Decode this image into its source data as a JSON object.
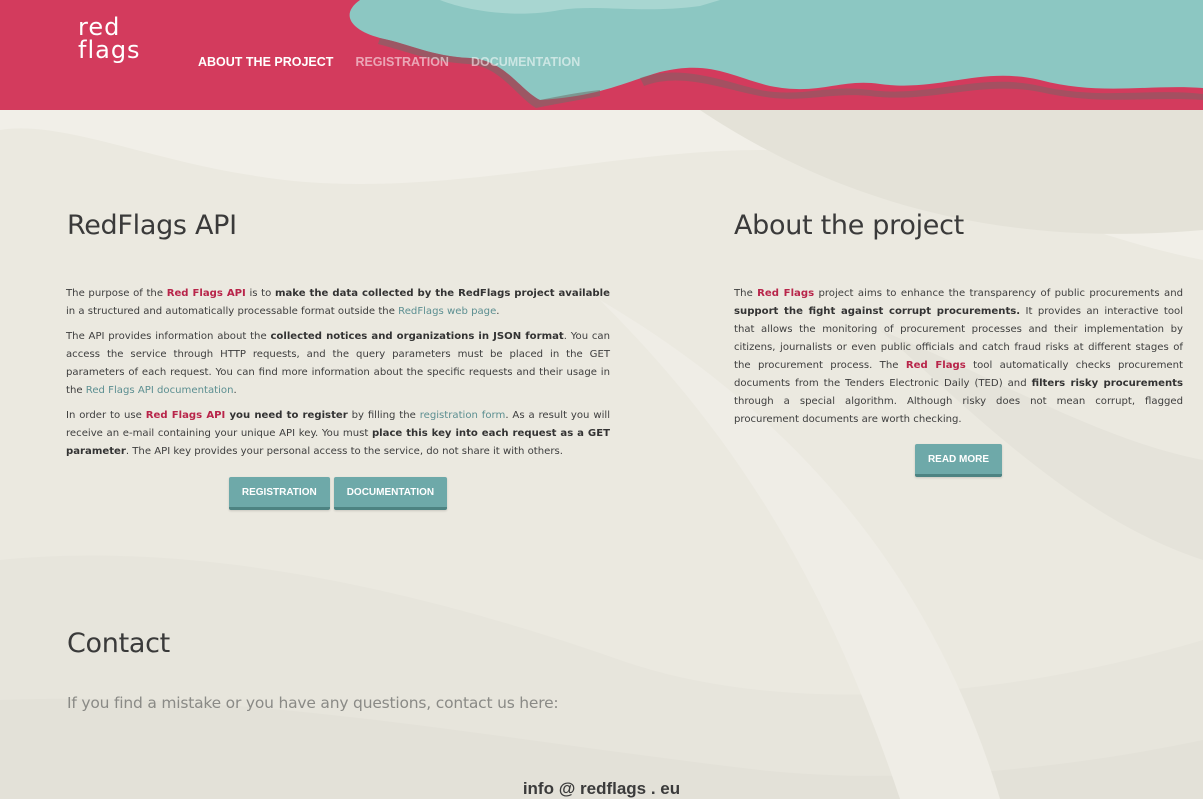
{
  "header": {
    "logo_line1": "red",
    "logo_line2": "flags",
    "nav": [
      {
        "label": "ABOUT THE PROJECT",
        "active": true
      },
      {
        "label": "REGISTRATION",
        "active": false
      },
      {
        "label": "DOCUMENTATION",
        "active": false
      }
    ],
    "colors": {
      "red": "#d43a5c",
      "teal": "#86c4bf"
    }
  },
  "api": {
    "title": "RedFlags API",
    "p1": {
      "t1": "The purpose of the ",
      "red1": "Red Flags API",
      "t2": " is to ",
      "b1": "make the data collected by the RedFlags project available",
      "t3": " in a structured and automatically processable format outside the ",
      "link1": "RedFlags web page",
      "t4": "."
    },
    "p2": {
      "t1": "The API provides information about the ",
      "b1": "collected notices and organizations in JSON format",
      "t2": ". You can access the service through HTTP requests, and the query parameters must be placed in the GET parameters of each request. You can find more information about the specific requests and their usage in the ",
      "link1": "Red Flags API documentation",
      "t3": "."
    },
    "p3": {
      "t1": "In order to use ",
      "red1": "Red Flags API",
      "b1": " you need to register",
      "t2": " by filling the ",
      "link1": "registration form",
      "t3": ". As a result you will receive an e-mail containing your unique API key. You must ",
      "b2": "place this key into each request as a GET parameter",
      "t4": ". The API key provides your personal access to the service, do not share it with others."
    },
    "buttons": {
      "registration": "REGISTRATION",
      "documentation": "DOCUMENTATION"
    }
  },
  "about": {
    "title": "About the project",
    "p1": {
      "t1": "The ",
      "red1": "Red Flags",
      "t2": " project aims to enhance the transparency of public procurements and ",
      "b1": "support the fight against corrupt procurements.",
      "t3": " It provides an interactive tool that allows the monitoring of procurement processes and their implementation by citizens, journalists or even public officials and catch fraud risks at different stages of the procurement process. The ",
      "red2": "Red Flags",
      "t4": " tool automatically checks procurement documents from the Tenders Electronic Daily (TED) and ",
      "b2": "filters risky procurements",
      "t5": " through a special algorithm. Although risky does not mean corrupt, flagged procurement documents are worth checking."
    },
    "read_more": "READ MORE"
  },
  "contact": {
    "title": "Contact",
    "text": "If you find a mistake or you have any questions, contact us here:",
    "email": "info @ redflags . eu"
  }
}
